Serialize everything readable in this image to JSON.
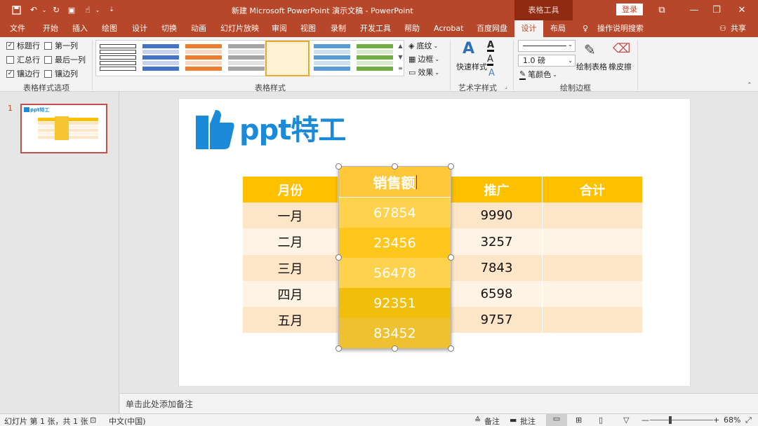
{
  "titlebar": {
    "doc_title": "新建 Microsoft PowerPoint 演示文稿 - PowerPoint",
    "context_tools": "表格工具",
    "login": "登录"
  },
  "tabs": [
    "文件",
    "开始",
    "插入",
    "绘图",
    "设计",
    "切换",
    "动画",
    "幻灯片放映",
    "审阅",
    "视图",
    "录制",
    "开发工具",
    "帮助",
    "Acrobat",
    "百度网盘",
    "设计",
    "布局"
  ],
  "active_tab": "设计",
  "tell_me": "操作说明搜索",
  "share": "共享",
  "ribbon": {
    "style_options": {
      "items": [
        {
          "label": "标题行",
          "checked": true
        },
        {
          "label": "第一列",
          "checked": false
        },
        {
          "label": "汇总行",
          "checked": false
        },
        {
          "label": "最后一列",
          "checked": false
        },
        {
          "label": "镶边行",
          "checked": true
        },
        {
          "label": "镶边列",
          "checked": false
        }
      ],
      "group_label": "表格样式选项"
    },
    "table_styles": {
      "group_label": "表格样式",
      "shading": "底纹",
      "borders": "边框",
      "effects": "效果",
      "thumbs": [
        {
          "color": "#ffffff",
          "stroke": "#444444"
        },
        {
          "color": "#4472c4",
          "stroke": "#c9d3ec"
        },
        {
          "color": "#ed7d31",
          "stroke": "#fbd8c4"
        },
        {
          "color": "#a5a5a5",
          "stroke": "#e2e2e2"
        },
        {
          "color": "#ffc000",
          "stroke": "#ffe8a6"
        },
        {
          "color": "#5b9bd5",
          "stroke": "#cfe0f1"
        },
        {
          "color": "#70ad47",
          "stroke": "#d7e8cb"
        }
      ]
    },
    "wordart": {
      "quick_styles": "快速样式",
      "group_label": "艺术字样式"
    },
    "draw_borders": {
      "pen_weight": "1.0 磅",
      "pen_color": "笔颜色",
      "draw_table": "绘制表格",
      "eraser": "橡皮擦",
      "group_label": "绘制边框"
    }
  },
  "slide_panel": {
    "slide_number": "1"
  },
  "slide": {
    "logo_text": "ppt特工",
    "table": {
      "headers": [
        "月份",
        "销售额",
        "推广",
        "合计"
      ],
      "rows": [
        [
          "一月",
          "67854",
          "9990",
          ""
        ],
        [
          "二月",
          "23456",
          "3257",
          ""
        ],
        [
          "三月",
          "56478",
          "7843",
          ""
        ],
        [
          "四月",
          "92351",
          "6598",
          ""
        ],
        [
          "五月",
          "83452",
          "9757",
          ""
        ]
      ]
    }
  },
  "notes_placeholder": "单击此处添加备注",
  "status": {
    "slide_info": "幻灯片 第 1 张，共 1 张",
    "language": "中文(中国)",
    "notes": "备注",
    "comments": "批注",
    "zoom": "68%"
  },
  "colors": {
    "brand": "#b7472a",
    "table_header": "#ffc000",
    "selected_column": "#f5c530"
  }
}
